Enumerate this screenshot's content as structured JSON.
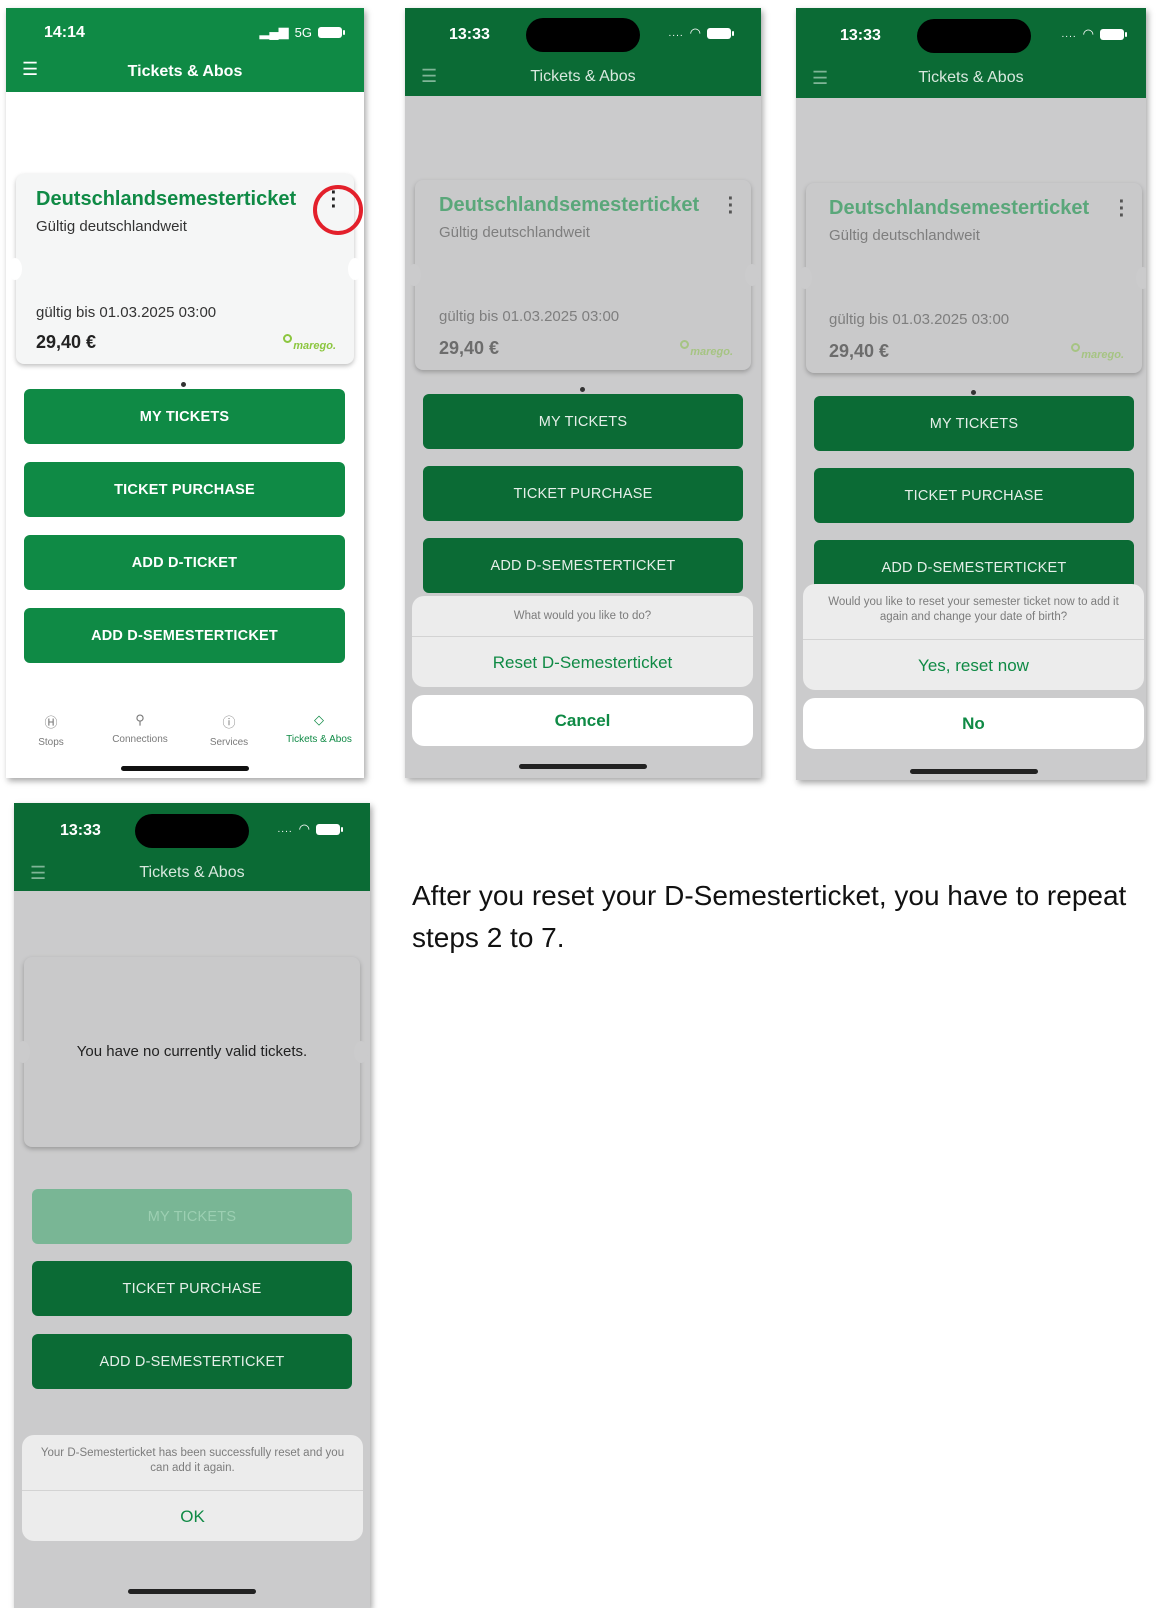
{
  "caption": "After you reset your D-Semesterticket, you have to repeat steps 2 to 7.",
  "colors": {
    "brand_green": "#0f8a45",
    "highlight_red": "#e3202b",
    "logo_green": "#8cc63f"
  },
  "screens": [
    {
      "time": "14:14",
      "network": "5G",
      "menu_icon": "☰",
      "title": "Tickets & Abos",
      "ticket": {
        "name": "Deutschlandsemesterticket",
        "scope": "Gültig deutschlandweit",
        "valid_until": "gültig bis 01.03.2025 03:00",
        "price": "29,40 €",
        "logo_text": "marego."
      },
      "buttons": [
        "MY TICKETS",
        "TICKET PURCHASE",
        "ADD D-TICKET",
        "ADD D-SEMESTERTICKET"
      ],
      "tabs": [
        {
          "label": "Stops",
          "icon": "stops-icon",
          "glyph": "Ⓗ"
        },
        {
          "label": "Connections",
          "icon": "connections-icon",
          "glyph": "⚲"
        },
        {
          "label": "Services",
          "icon": "info-icon",
          "glyph": "ⓘ"
        },
        {
          "label": "Tickets & Abos",
          "icon": "ticket-icon",
          "glyph": "◇",
          "active": true
        }
      ]
    },
    {
      "time": "13:33",
      "menu_icon": "☰",
      "title": "Tickets & Abos",
      "ticket": {
        "name": "Deutschlandsemesterticket",
        "scope": "Gültig deutschlandweit",
        "valid_until": "gültig bis 01.03.2025 03:00",
        "price": "29,40 €",
        "logo_text": "marego."
      },
      "buttons": [
        "MY TICKETS",
        "TICKET PURCHASE",
        "ADD D-SEMESTERTICKET"
      ],
      "sheet": {
        "message": "What would you like to do?",
        "action": "Reset D-Semesterticket",
        "cancel": "Cancel"
      }
    },
    {
      "time": "13:33",
      "menu_icon": "☰",
      "title": "Tickets & Abos",
      "ticket": {
        "name": "Deutschlandsemesterticket",
        "scope": "Gültig deutschlandweit",
        "valid_until": "gültig bis 01.03.2025 03:00",
        "price": "29,40 €",
        "logo_text": "marego."
      },
      "buttons": [
        "MY TICKETS",
        "TICKET PURCHASE",
        "ADD D-SEMESTERTICKET"
      ],
      "sheet": {
        "message": "Would you like to reset your semester ticket now to add it again and change your date of birth?",
        "action": "Yes, reset now",
        "cancel": "No"
      }
    },
    {
      "time": "13:33",
      "menu_icon": "☰",
      "title": "Tickets & Abos",
      "empty_message": "You have no currently valid tickets.",
      "buttons": [
        "MY TICKETS",
        "TICKET PURCHASE",
        "ADD D-SEMESTERTICKET"
      ],
      "alert": {
        "message": "Your D-Semesterticket has been successfully reset and you can add it again.",
        "action": "OK"
      }
    }
  ]
}
